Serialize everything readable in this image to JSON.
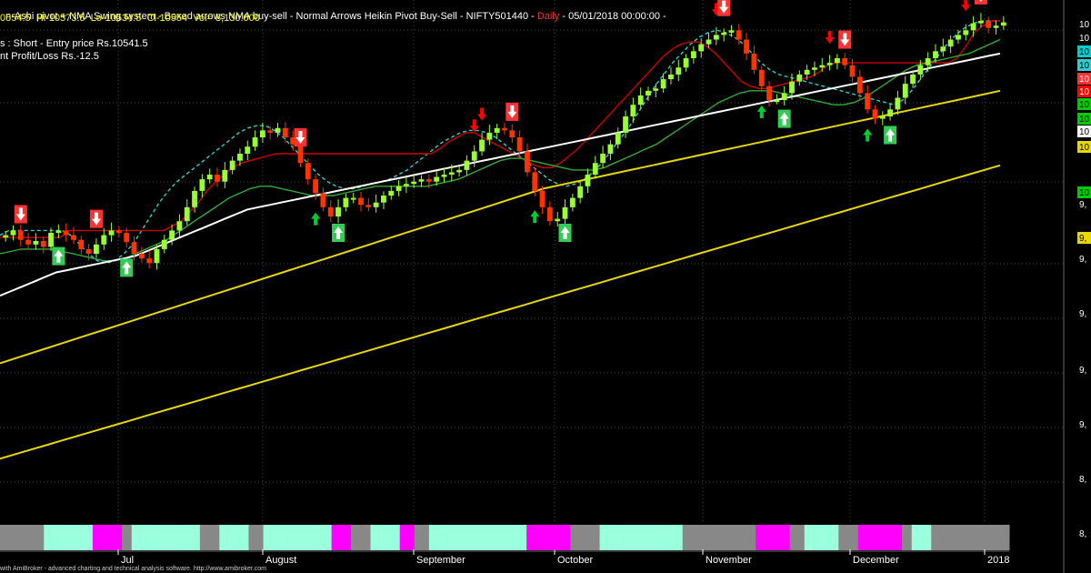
{
  "header": {
    "title": "n-Ashi pivot + NMA Swing system - Boxed arrows NMA buy-sell - Normal Arrows Heikin Pivot Buy-Sell - NIFTY501440 - ",
    "interval": "Daily",
    "date": " - 05/01/2018 00:00:00 -",
    "ohlc": "0554.5  Hi-10573.5  Lo-10534.5  Cl-10554  Vol= 8,130.000",
    "position_line": "s : Short - Entry price Rs.10541.5",
    "pl_line": "nt Profit/Loss Rs.-12.5"
  },
  "footer": {
    "credit": "with AmiBroker - advanced charting and technical analysis software. http://www.amibroker.com"
  },
  "colors": {
    "background": "#000000",
    "bull_candle": "#99ff33",
    "bear_candle": "#ff3300",
    "cyan_dashed": "#33cccc",
    "red_line": "#cc0000",
    "white_line": "#ffffff",
    "yellow_line": "#e6d800",
    "green_line": "#33aa33",
    "buy_arrow": "#00cc33",
    "sell_arrow": "#ff0000",
    "ribbon_gray": "#888888",
    "ribbon_magenta": "#ff00ff",
    "ribbon_aqua": "#99ffdd"
  },
  "chart_data": {
    "type": "candlestick",
    "symbol": "NIFTY501440",
    "interval": "Daily",
    "x_ticks": [
      "Jul",
      "August",
      "September",
      "October",
      "November",
      "December",
      "2018"
    ],
    "y_tick_labels": [
      "10",
      "10",
      "10",
      "10",
      "10",
      "10",
      "10",
      "10",
      "10",
      "10",
      "10",
      "9,",
      "9,",
      "9,",
      "9,",
      "9,",
      "9,",
      "8,",
      "8,"
    ],
    "ylim": [
      8400,
      10650
    ],
    "closes": [
      9640,
      9660,
      9620,
      9600,
      9615,
      9590,
      9650,
      9660,
      9640,
      9620,
      9580,
      9560,
      9600,
      9640,
      9660,
      9650,
      9610,
      9560,
      9540,
      9520,
      9580,
      9620,
      9660,
      9700,
      9760,
      9830,
      9880,
      9900,
      9870,
      9920,
      9960,
      9990,
      10020,
      10060,
      10090,
      10080,
      10100,
      10060,
      10030,
      9950,
      9880,
      9820,
      9760,
      9720,
      9760,
      9800,
      9800,
      9770,
      9760,
      9780,
      9810,
      9830,
      9850,
      9860,
      9870,
      9880,
      9870,
      9890,
      9900,
      9910,
      9920,
      9960,
      10000,
      10050,
      10080,
      10100,
      10090,
      10060,
      10000,
      9910,
      9830,
      9760,
      9700,
      9710,
      9760,
      9800,
      9850,
      9900,
      9950,
      9990,
      10030,
      10080,
      10150,
      10200,
      10240,
      10260,
      10270,
      10310,
      10330,
      10360,
      10400,
      10430,
      10460,
      10480,
      10500,
      10510,
      10520,
      10480,
      10420,
      10350,
      10280,
      10220,
      10220,
      10250,
      10300,
      10330,
      10350,
      10360,
      10370,
      10380,
      10400,
      10370,
      10320,
      10250,
      10180,
      10140,
      10150,
      10180,
      10230,
      10290,
      10330,
      10370,
      10400,
      10430,
      10450,
      10480,
      10500,
      10520,
      10550,
      10560,
      10530,
      10540,
      10554
    ],
    "entry_price": 10541.5,
    "profit_loss": -12.5,
    "overlay_lines": [
      {
        "name": "cyan-dashed",
        "style": "dashed",
        "values": [
          9640,
          9660,
          9660,
          9660,
          9660,
          9660,
          9660,
          9660,
          9640,
          9600,
          9560,
          9530,
          9520,
          9530,
          9560,
          9600,
          9660,
          9720,
          9780,
          9830,
          9870,
          9900,
          9930,
          9960,
          9990,
          10020,
          10050,
          10080,
          10100,
          10110,
          10110,
          10090,
          10060,
          10020,
          9980,
          9940,
          9900,
          9870,
          9850,
          9840,
          9840,
          9850,
          9860,
          9870,
          9880,
          9900,
          9920,
          9950,
          9980,
          10010,
          10040,
          10060,
          10080,
          10090,
          10090,
          10080,
          10060,
          10030,
          10000,
          9970,
          9940,
          9910,
          9880,
          9860,
          9850,
          9860,
          9880,
          9910,
          9950,
          10000,
          10050,
          10100,
          10160,
          10220,
          10280,
          10330,
          10380,
          10420,
          10460,
          10490,
          10510,
          10520,
          10510,
          10490,
          10460,
          10420,
          10380,
          10350,
          10330,
          10320,
          10310,
          10300,
          10290,
          10280,
          10270,
          10260,
          10250,
          10240,
          10230,
          10220,
          10210,
          10200,
          10220,
          10260,
          10310,
          10360,
          10410,
          10460,
          10500,
          10530,
          10550,
          10560,
          10560,
          10560
        ]
      },
      {
        "name": "red",
        "style": "solid",
        "values": [
          9630,
          9630,
          9630,
          9630,
          9630,
          9630,
          9630,
          9630,
          9660,
          9660,
          9660,
          9660,
          9660,
          9660,
          9660,
          9660,
          9660,
          9660,
          9660,
          9660,
          9680,
          9700,
          9740,
          9780,
          9830,
          9870,
          9900,
          9930,
          9950,
          9960,
          9970,
          9980,
          9990,
          9990,
          9990,
          9990,
          9990,
          9990,
          9990,
          9990,
          9990,
          9990,
          9990,
          9990,
          9990,
          9990,
          9990,
          9990,
          9990,
          9990,
          9990,
          10010,
          10040,
          10060,
          10080,
          10080,
          10060,
          10040,
          10020,
          10000,
          9980,
          9960,
          9940,
          9930,
          9930,
          9950,
          9980,
          10010,
          10050,
          10090,
          10130,
          10170,
          10210,
          10250,
          10290,
          10330,
          10370,
          10410,
          10440,
          10460,
          10470,
          10470,
          10450,
          10420,
          10380,
          10340,
          10300,
          10280,
          10270,
          10270,
          10280,
          10290,
          10300,
          10310,
          10320,
          10340,
          10370,
          10380,
          10380,
          10380,
          10380,
          10380,
          10380,
          10380,
          10380,
          10380,
          10380,
          10380,
          10380,
          10380,
          10380,
          10400,
          10450,
          10510,
          10540,
          10560,
          10560
        ]
      },
      {
        "name": "green",
        "style": "solid",
        "values": [
          9560,
          9570,
          9580,
          9580,
          9580,
          9580,
          9570,
          9560,
          9550,
          9540,
          9530,
          9530,
          9540,
          9560,
          9580,
          9600,
          9620,
          9650,
          9680,
          9710,
          9740,
          9770,
          9800,
          9820,
          9840,
          9850,
          9850,
          9840,
          9830,
          9820,
          9810,
          9810,
          9810,
          9820,
          9830,
          9840,
          9850,
          9850,
          9850,
          9850,
          9850,
          9850,
          9860,
          9870,
          9880,
          9900,
          9920,
          9940,
          9960,
          9970,
          9970,
          9960,
          9950,
          9940,
          9930,
          9920,
          9920,
          9920,
          9930,
          9950,
          9970,
          9990,
          10010,
          10030,
          10060,
          10090,
          10120,
          10150,
          10180,
          10210,
          10230,
          10250,
          10260,
          10260,
          10260,
          10250,
          10240,
          10230,
          10220,
          10210,
          10200,
          10200,
          10210,
          10230,
          10260,
          10290,
          10320,
          10350,
          10370,
          10380,
          10390,
          10400,
          10410,
          10420,
          10440,
          10460,
          10480
        ]
      },
      {
        "name": "white",
        "style": "solid",
        "values": [
          9380,
          9400,
          9420,
          9440,
          9460,
          9480,
          9490,
          9500,
          9510,
          9520,
          9530,
          9540,
          9550,
          9570,
          9590,
          9610,
          9630,
          9650,
          9670,
          9690,
          9710,
          9730,
          9750,
          9760,
          9770,
          9780,
          9790,
          9800,
          9810,
          9820,
          9830,
          9840,
          9850,
          9860,
          9870,
          9880,
          9890,
          9900,
          9910,
          9920,
          9930,
          9940,
          9950,
          9960,
          9970,
          9980,
          9990,
          10000,
          10010,
          10020,
          10030,
          10040,
          10050,
          10060,
          10070,
          10080,
          10090,
          10100,
          10110,
          10120,
          10130,
          10140,
          10150,
          10160,
          10170,
          10180,
          10190,
          10200,
          10210,
          10220,
          10230,
          10240,
          10250,
          10260,
          10270,
          10280,
          10290,
          10300,
          10310,
          10320,
          10330,
          10340,
          10350,
          10360,
          10370,
          10380,
          10390,
          10400,
          10410,
          10420
        ]
      },
      {
        "name": "yellow-upper",
        "style": "solid",
        "values": [
          9090,
          9120,
          9150,
          9180,
          9210,
          9240,
          9270,
          9300,
          9330,
          9360,
          9390,
          9420,
          9450,
          9480,
          9510,
          9540,
          9570,
          9600,
          9630,
          9660,
          9690,
          9720,
          9750,
          9780,
          9810,
          9840,
          9860,
          9880,
          9900,
          9920,
          9940,
          9960,
          9980,
          10000,
          10020,
          10040,
          10060,
          10080,
          10100,
          10120,
          10140,
          10160,
          10180,
          10200,
          10220,
          10240,
          10260
        ]
      },
      {
        "name": "yellow-lower",
        "style": "solid",
        "values": [
          8680,
          8700,
          8720,
          8740,
          8760,
          8780,
          8800,
          8820,
          8840,
          8860,
          8880,
          8900,
          8920,
          8940,
          8960,
          8980,
          9000,
          9020,
          9040,
          9060,
          9080,
          9100,
          9120,
          9140,
          9160,
          9180,
          9200,
          9220,
          9240,
          9260,
          9280,
          9300,
          9320,
          9340,
          9360,
          9380,
          9400,
          9420,
          9440,
          9460,
          9480,
          9500,
          9520,
          9540,
          9560,
          9580,
          9600,
          9620,
          9640,
          9660,
          9680,
          9700,
          9720,
          9740,
          9760,
          9780,
          9800,
          9820,
          9840,
          9860,
          9880,
          9900,
          9920,
          9940
        ]
      }
    ],
    "signals": [
      {
        "type": "sell-boxed",
        "bar": 4
      },
      {
        "type": "sell-boxed",
        "bar": 20
      },
      {
        "type": "buy-boxed",
        "bar": 12
      },
      {
        "type": "buy-boxed",
        "bar": 26
      },
      {
        "type": "sell-boxed",
        "bar": 64
      },
      {
        "type": "buy-boxed",
        "bar": 73
      },
      {
        "type": "sell",
        "bar": 102
      },
      {
        "type": "buy",
        "bar": 67
      },
      {
        "type": "sell-boxed",
        "bar": 110
      },
      {
        "type": "sell",
        "bar": 104
      },
      {
        "type": "buy",
        "bar": 115
      },
      {
        "type": "buy-boxed",
        "bar": 122
      },
      {
        "type": "sell",
        "bar": 155
      },
      {
        "type": "sell-boxed",
        "bar": 157
      },
      {
        "type": "buy",
        "bar": 166
      },
      {
        "type": "buy-boxed",
        "bar": 171
      },
      {
        "type": "sell",
        "bar": 180
      },
      {
        "type": "sell-boxed",
        "bar": 184
      },
      {
        "type": "buy",
        "bar": 189
      },
      {
        "type": "buy-boxed",
        "bar": 193
      },
      {
        "type": "sell",
        "bar": 210
      },
      {
        "type": "sell-boxed",
        "bar": 214
      }
    ],
    "ribbon_segments": [
      {
        "state": "gray",
        "len": 9
      },
      {
        "state": "aqua",
        "len": 10
      },
      {
        "state": "magenta",
        "len": 6
      },
      {
        "state": "gray",
        "len": 2
      },
      {
        "state": "aqua",
        "len": 14
      },
      {
        "state": "gray",
        "len": 4
      },
      {
        "state": "aqua",
        "len": 6
      },
      {
        "state": "gray",
        "len": 3
      },
      {
        "state": "aqua",
        "len": 14
      },
      {
        "state": "magenta",
        "len": 4
      },
      {
        "state": "gray",
        "len": 4
      },
      {
        "state": "aqua",
        "len": 6
      },
      {
        "state": "magenta",
        "len": 3
      },
      {
        "state": "gray",
        "len": 3
      },
      {
        "state": "aqua",
        "len": 15
      },
      {
        "state": "aqua",
        "len": 5
      },
      {
        "state": "magenta",
        "len": 9
      },
      {
        "state": "gray",
        "len": 6
      },
      {
        "state": "aqua",
        "len": 17
      },
      {
        "state": "gray",
        "len": 15
      },
      {
        "state": "magenta",
        "len": 7
      },
      {
        "state": "gray",
        "len": 3
      },
      {
        "state": "aqua",
        "len": 7
      },
      {
        "state": "gray",
        "len": 4
      },
      {
        "state": "magenta",
        "len": 9
      },
      {
        "state": "gray",
        "len": 2
      },
      {
        "state": "aqua",
        "len": 4
      },
      {
        "state": "gray",
        "len": 16
      }
    ],
    "grid": true,
    "legend": "none"
  }
}
